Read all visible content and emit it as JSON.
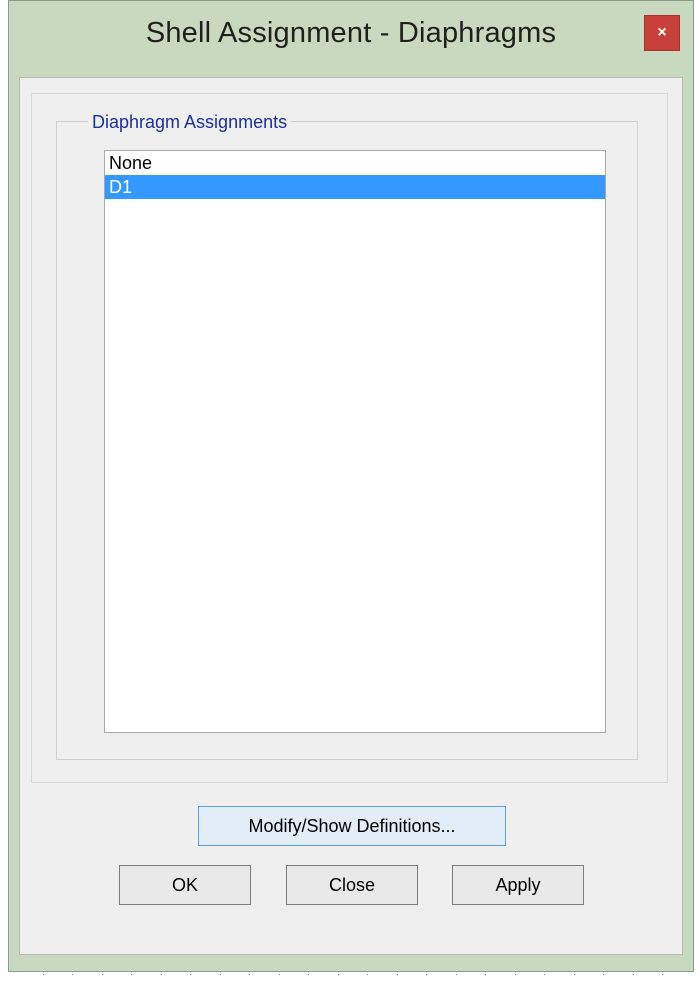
{
  "window": {
    "title": "Shell Assignment - Diaphragms",
    "close_glyph": "×"
  },
  "group": {
    "label": "Diaphragm Assignments"
  },
  "list": {
    "items": [
      {
        "label": "None",
        "selected": false
      },
      {
        "label": "D1",
        "selected": true
      }
    ]
  },
  "buttons": {
    "modify_label": "Modify/Show Definitions...",
    "ok_label": "OK",
    "close_label": "Close",
    "apply_label": "Apply"
  },
  "colors": {
    "titlebar_bg": "#c9d9bf",
    "selection_bg": "#3399ff",
    "group_label_color": "#1b2f9e",
    "close_button_bg": "#c7413a"
  },
  "icons": {
    "close": "close-icon"
  }
}
